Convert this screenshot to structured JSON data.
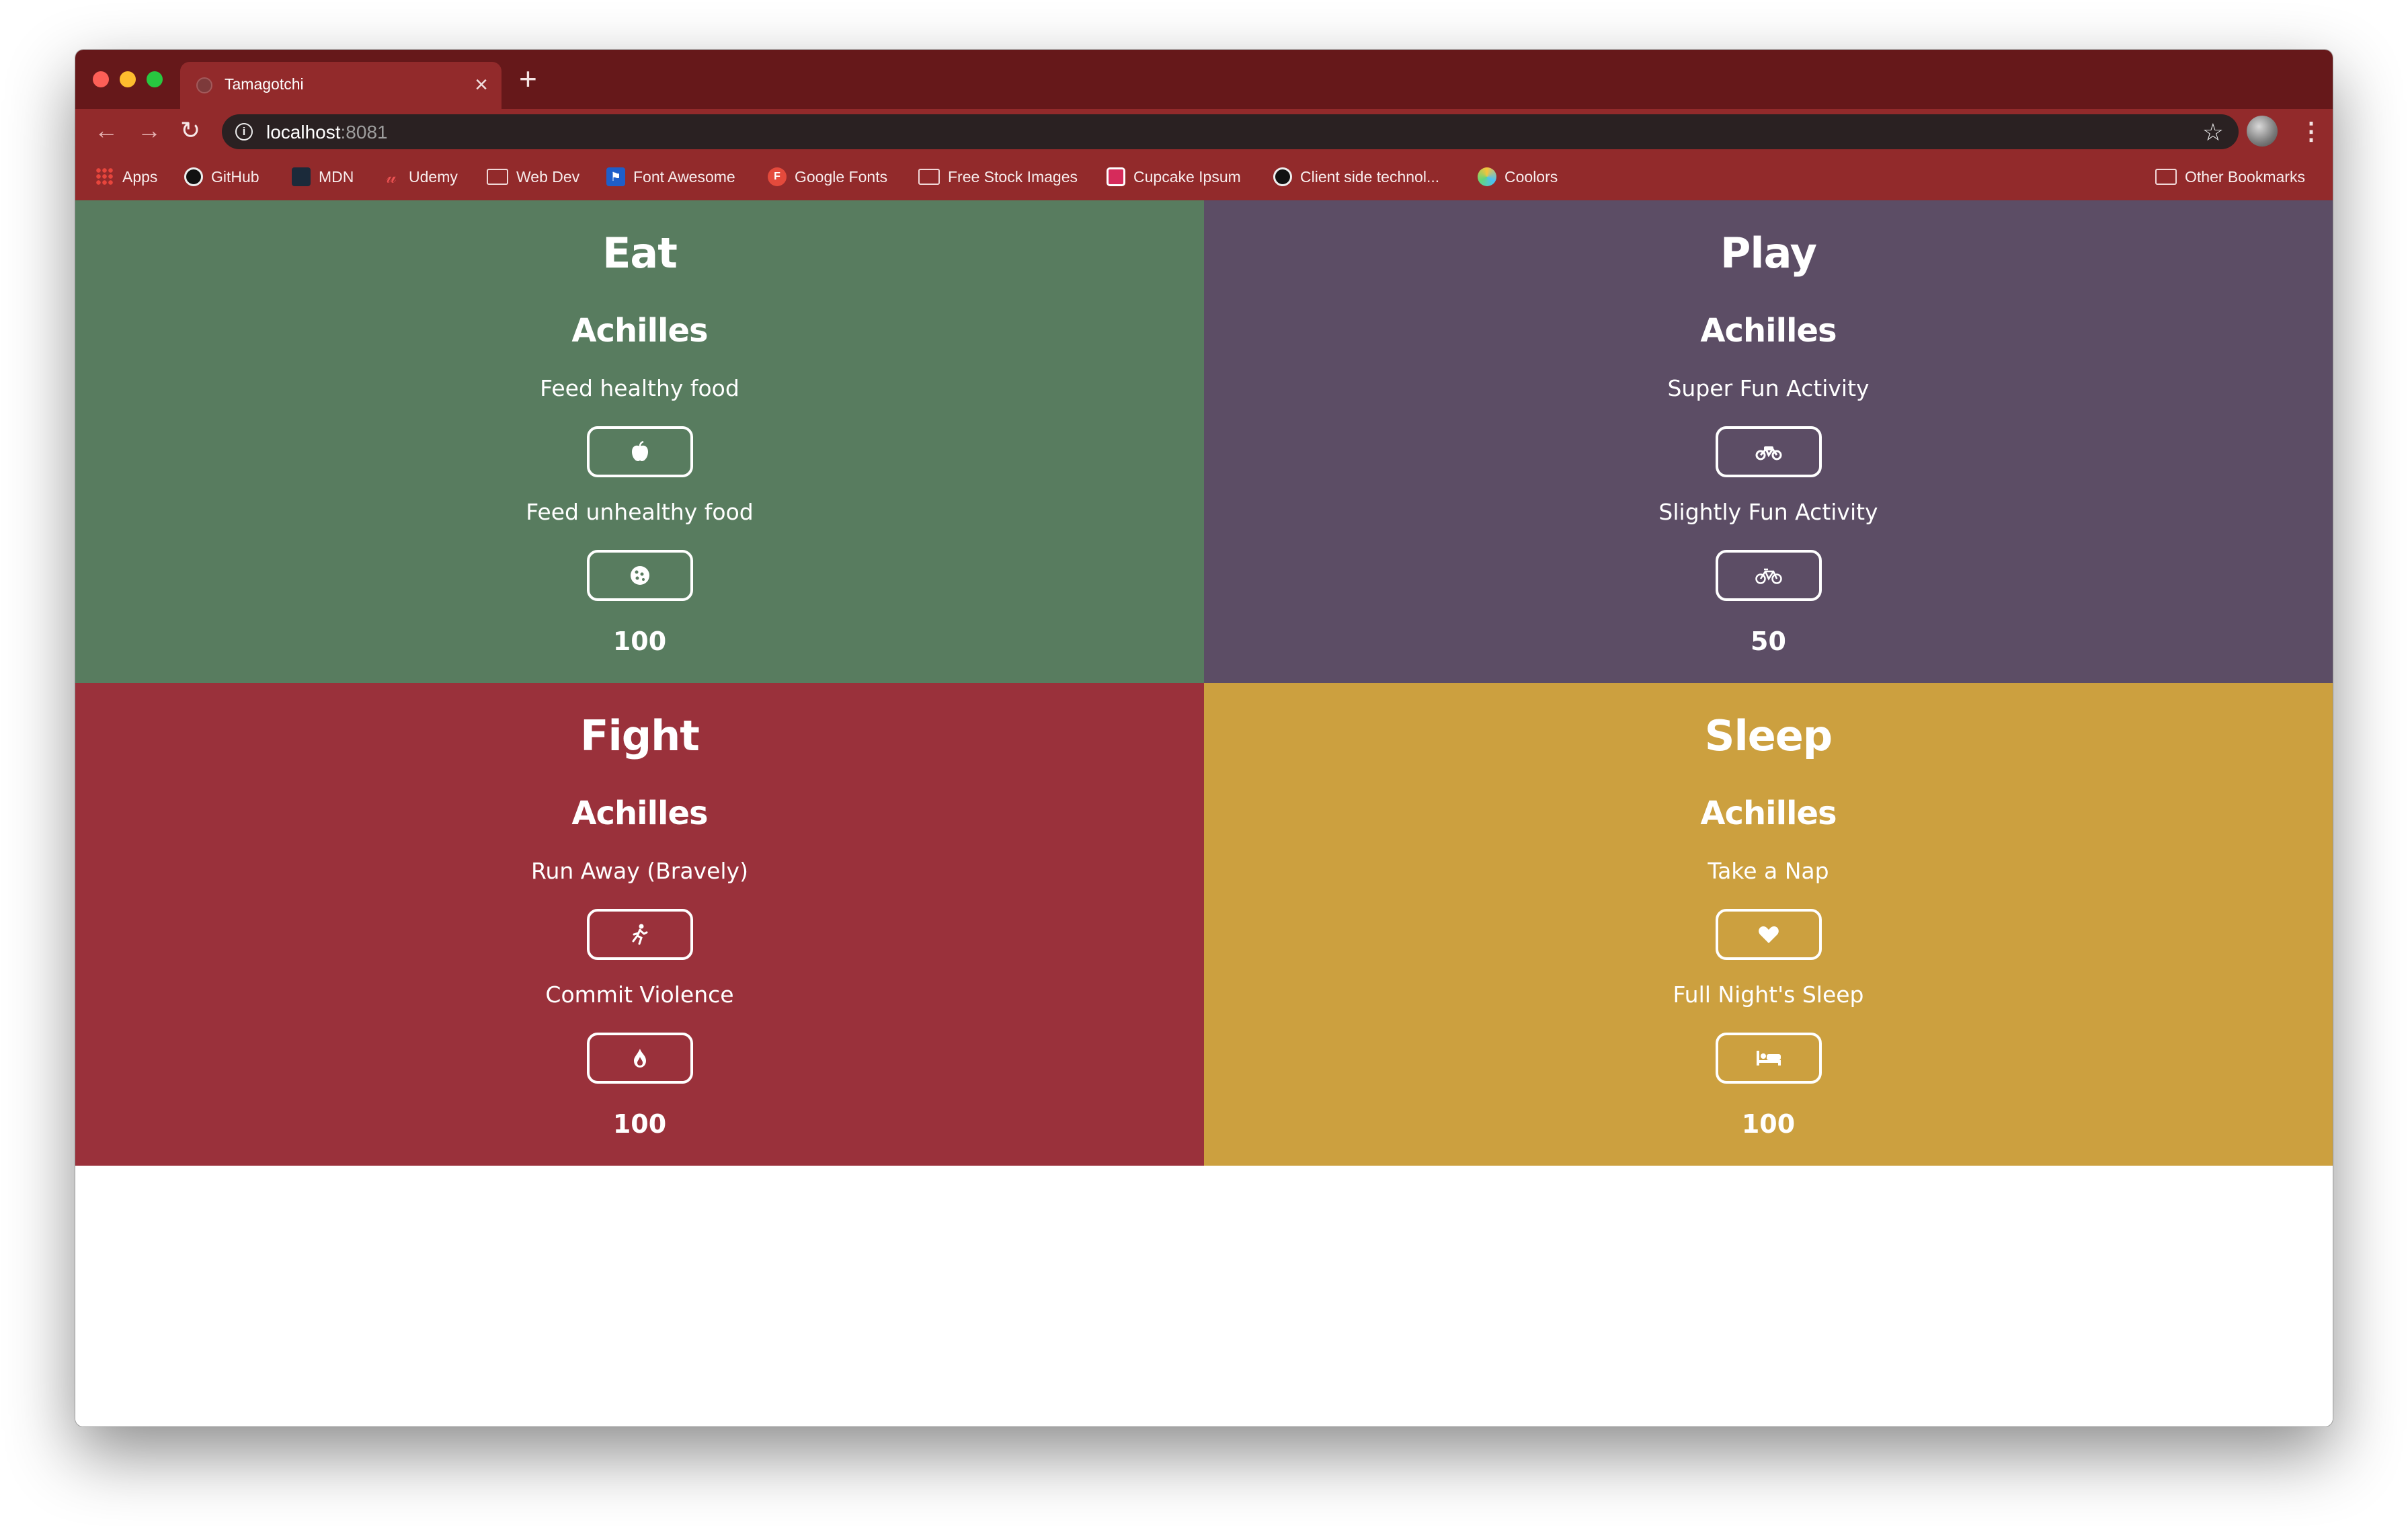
{
  "browser": {
    "tab_title": "Tamagotchi",
    "tab_close": "×",
    "new_tab": "+",
    "url_host": "localhost",
    "url_port": ":8081",
    "bookmarks": [
      "Apps",
      "GitHub",
      "MDN",
      "Udemy",
      "Web Dev",
      "Font Awesome",
      "Google Fonts",
      "Free Stock Images",
      "Cupcake Ipsum",
      "Client side technol...",
      "Coolors"
    ],
    "other_bookmarks": "Other Bookmarks"
  },
  "panels": {
    "eat": {
      "title": "Eat",
      "pet": "Achilles",
      "action1": "Feed healthy food",
      "action2": "Feed unhealthy food",
      "icon1": "apple-icon",
      "icon2": "cookie-icon",
      "value": "100",
      "color": "#587c5f"
    },
    "play": {
      "title": "Play",
      "pet": "Achilles",
      "action1": "Super Fun Activity",
      "action2": "Slightly Fun Activity",
      "icon1": "motorcycle-icon",
      "icon2": "bicycle-icon",
      "value": "50",
      "color": "#5c4d65"
    },
    "fight": {
      "title": "Fight",
      "pet": "Achilles",
      "action1": "Run Away (Bravely)",
      "action2": "Commit Violence",
      "icon1": "running-icon",
      "icon2": "fire-icon",
      "value": "100",
      "color": "#9a313b"
    },
    "sleep": {
      "title": "Sleep",
      "pet": "Achilles",
      "action1": "Take a Nap",
      "action2": "Full Night's Sleep",
      "icon1": "heart-icon",
      "icon2": "bed-icon",
      "value": "100",
      "color": "#cca03f"
    }
  }
}
